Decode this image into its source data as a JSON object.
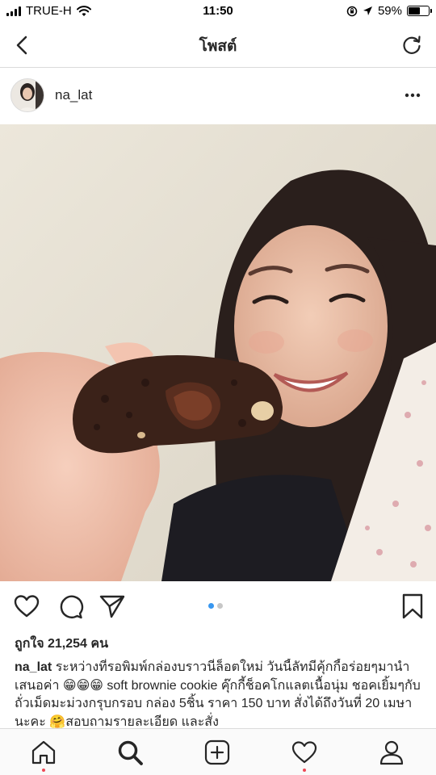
{
  "status_bar": {
    "carrier": "TRUE-H",
    "time": "11:50",
    "battery_percent": "59%",
    "battery_level": 0.59
  },
  "nav": {
    "title": "โพสต์",
    "back_icon": "chevron-left-icon",
    "refresh_icon": "refresh-icon"
  },
  "post": {
    "username": "na_lat",
    "more_icon": "more-horizontal-icon",
    "carousel": {
      "count": 2,
      "active_index": 0
    },
    "likes_text": "ถูกใจ 21,254 คน",
    "caption_user": "na_lat",
    "caption_text": " ระหว่างที่รอพิมพ์กล่องบราวนี่ล็อตใหม่ วันนี้ลัทมีคุ้กกี้อร่อยๆมานำเสนอค่า 😁😁😁 soft brownie cookie คุ๊กกี้ช็อคโกแลตเนื้อนุ่ม ชอคเยิ้มๆกับถั่วเม็ดมะม่วงกรุบกรอบ กล่อง 5ชิ้น ราคา 150 บาท สั่งได้ถึงวันที่ 20 เมษานะคะ 🤗สอบถามรายละเอียด และสั่ง"
  },
  "actions": {
    "like_icon": "heart-icon",
    "comment_icon": "comment-icon",
    "share_icon": "send-icon",
    "save_icon": "bookmark-icon"
  },
  "tabbar": {
    "items": [
      "home-icon",
      "search-icon",
      "add-icon",
      "activity-heart-icon",
      "profile-icon"
    ],
    "accent_color": "#ed4956"
  },
  "colors": {
    "text": "#262626",
    "border": "#dbdbdb",
    "carousel_active": "#3897f0"
  }
}
